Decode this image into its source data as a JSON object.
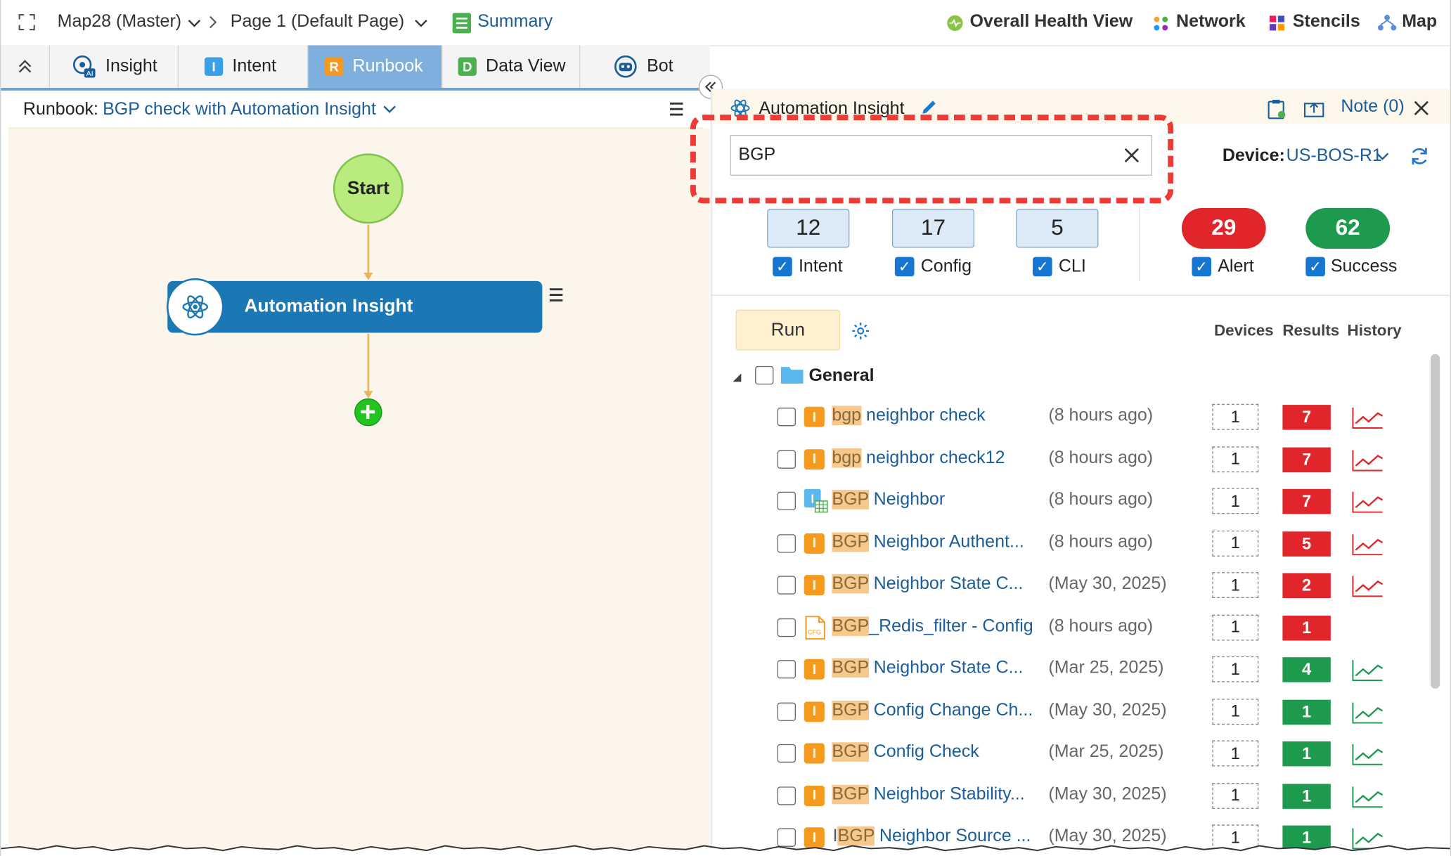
{
  "topbar": {
    "map_name": "Map28 (Master)",
    "page_name": "Page 1  (Default Page)",
    "summary": "Summary",
    "health": "Overall Health View",
    "network": "Network",
    "stencils": "Stencils",
    "map": "Map"
  },
  "tabs": [
    {
      "label": "Insight"
    },
    {
      "label": "Intent",
      "icon": "I"
    },
    {
      "label": "Runbook",
      "icon": "R"
    },
    {
      "label": "Data View",
      "icon": "D"
    },
    {
      "label": "Bot"
    }
  ],
  "runbook": {
    "prefix": "Runbook:",
    "name": "BGP check with Automation Insight",
    "start": "Start",
    "node": "Automation Insight"
  },
  "panel": {
    "title": "Automation Insight",
    "note": "Note (0)",
    "search_value": "BGP",
    "device_label": "Device:",
    "device_value": "US-BOS-R1",
    "filters": [
      {
        "count": "12",
        "label": "Intent"
      },
      {
        "count": "17",
        "label": "Config"
      },
      {
        "count": "5",
        "label": "CLI"
      },
      {
        "count": "29",
        "label": "Alert"
      },
      {
        "count": "62",
        "label": "Success"
      }
    ],
    "run_label": "Run",
    "col_devices": "Devices",
    "col_results": "Results",
    "col_history": "History",
    "folder": "General",
    "colors": {
      "alert": "#e0262b",
      "success": "#1e9a4f",
      "link": "#1a5d9a"
    }
  },
  "rows": [
    {
      "hl": "bgp",
      "rest": " neighbor check",
      "time": "(8 hours ago)",
      "devices": "1",
      "results": "7",
      "status": "alert",
      "icon": "I"
    },
    {
      "hl": "bgp",
      "rest": " neighbor check12",
      "time": "(8 hours ago)",
      "devices": "1",
      "results": "7",
      "status": "alert",
      "icon": "I"
    },
    {
      "hl": "BGP",
      "rest": " Neighbor",
      "time": "(8 hours ago)",
      "devices": "1",
      "results": "7",
      "status": "alert",
      "icon": "grid"
    },
    {
      "hl": "BGP",
      "rest": " Neighbor Authent...",
      "time": "(8 hours ago)",
      "devices": "1",
      "results": "5",
      "status": "alert",
      "icon": "I"
    },
    {
      "hl": "BGP",
      "rest": " Neighbor State C...",
      "time": "(May 30, 2025)",
      "devices": "1",
      "results": "2",
      "status": "alert",
      "icon": "I"
    },
    {
      "hl": "BGP",
      "rest": "_Redis_filter - Config",
      "time": "(8 hours ago)",
      "devices": "1",
      "results": "1",
      "status": "alert",
      "icon": "cfg",
      "nohistory": true
    },
    {
      "hl": "BGP",
      "rest": " Neighbor State C...",
      "time": "(Mar 25, 2025)",
      "devices": "1",
      "results": "4",
      "status": "success",
      "icon": "I"
    },
    {
      "hl": "BGP",
      "rest": " Config Change Ch...",
      "time": "(May 30, 2025)",
      "devices": "1",
      "results": "1",
      "status": "success",
      "icon": "I"
    },
    {
      "hl": "BGP",
      "rest": " Config Check",
      "time": "(Mar 25, 2025)",
      "devices": "1",
      "results": "1",
      "status": "success",
      "icon": "I"
    },
    {
      "hl": "BGP",
      "rest": " Neighbor Stability...",
      "time": "(May 30, 2025)",
      "devices": "1",
      "results": "1",
      "status": "success",
      "icon": "I"
    },
    {
      "hl": "BGP",
      "rest": " Neighbor Source ...",
      "time": "(May 30, 2025)",
      "devices": "1",
      "results": "1",
      "status": "success",
      "icon": "I",
      "prefix": "I"
    }
  ]
}
